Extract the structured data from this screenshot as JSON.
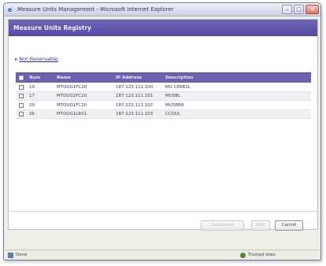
{
  "window": {
    "title": "Measure Units Management - Microsoft Internet Explorer",
    "minimize_glyph": "–",
    "maximize_glyph": "□",
    "close_glyph": "✕"
  },
  "page": {
    "header_title": "Measure Units Registry",
    "section_link": "Not Reservable",
    "bullet": "▸"
  },
  "table": {
    "columns": [
      "Num",
      "Name",
      "IP Address",
      "Description"
    ],
    "rows": [
      {
        "id": "10",
        "name": "MTOUG1FC20",
        "ip": "187.123.111.100",
        "desc": "MU CERB1L"
      },
      {
        "id": "17",
        "name": "MTOUG1FC20",
        "ip": "187.123.111.101",
        "desc": "MU5BL"
      },
      {
        "id": "20",
        "name": "MTOUG1FC20",
        "ip": "187.123.111.102",
        "desc": "MU5BB8"
      },
      {
        "id": "26",
        "name": "MTOUG1LR01",
        "ip": "187.123.111.103",
        "desc": "CCOUL"
      }
    ]
  },
  "buttons": {
    "unreserve": "Unreserve",
    "edit": "Edit",
    "cancel": "Cancel"
  },
  "status": {
    "left_text": "Done",
    "right_text": "Trusted sites"
  },
  "colors": {
    "header": "#5549a4",
    "table_header": "#6b62ad",
    "link": "#2f3a88"
  }
}
